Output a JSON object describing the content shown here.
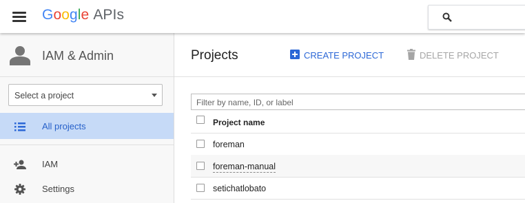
{
  "topbar": {
    "logo_letters": [
      "G",
      "o",
      "o",
      "g",
      "l",
      "e"
    ],
    "product": "APIs"
  },
  "sidebar": {
    "title": "IAM & Admin",
    "project_select_placeholder": "Select a project",
    "items": [
      {
        "label": "All projects",
        "active": true,
        "icon": "list-icon"
      },
      {
        "label": "IAM",
        "active": false,
        "icon": "person-add-icon"
      },
      {
        "label": "Settings",
        "active": false,
        "icon": "gear-icon"
      }
    ]
  },
  "main": {
    "title": "Projects",
    "create_label": "CREATE PROJECT",
    "delete_label": "DELETE PROJECT",
    "filter_placeholder": "Filter by name, ID, or label",
    "table": {
      "column_header": "Project name",
      "rows": [
        "foreman",
        "foreman-manual",
        "setichatlobato"
      ]
    }
  },
  "colors": {
    "accent": "#2b67d6",
    "active_item_bg": "#c6daf7",
    "disabled_text": "#a5a5a5"
  }
}
